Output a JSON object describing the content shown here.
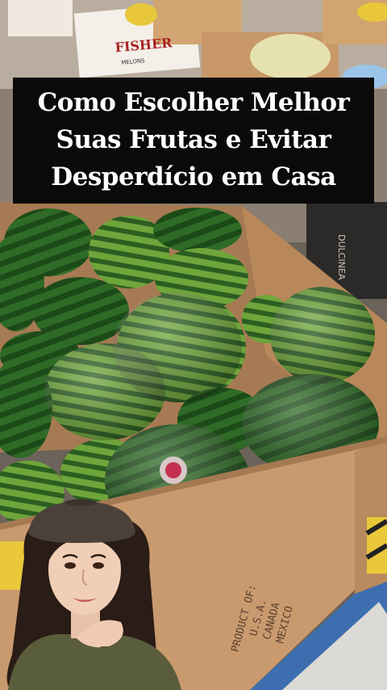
{
  "caption": {
    "lines": [
      "Como Escolher Melhor",
      "Suas Frutas e Evitar",
      "Desperdício em Casa"
    ]
  },
  "background_labels": {
    "box_brand": "FISHER",
    "box_sub": "MELONS",
    "crate_brand": "DULCINEA"
  },
  "box_print": {
    "line1": "PRODUCT OF:",
    "line2": "U.S.A.",
    "line3": "CANADA",
    "line4": "MEXICO"
  },
  "colors": {
    "caption_bg": "#0a0a0a",
    "caption_text": "#ffffff",
    "cardboard": "#c99a6e",
    "watermelon_dark": "#1f4d1c",
    "watermelon_light": "#8fbf4a"
  }
}
